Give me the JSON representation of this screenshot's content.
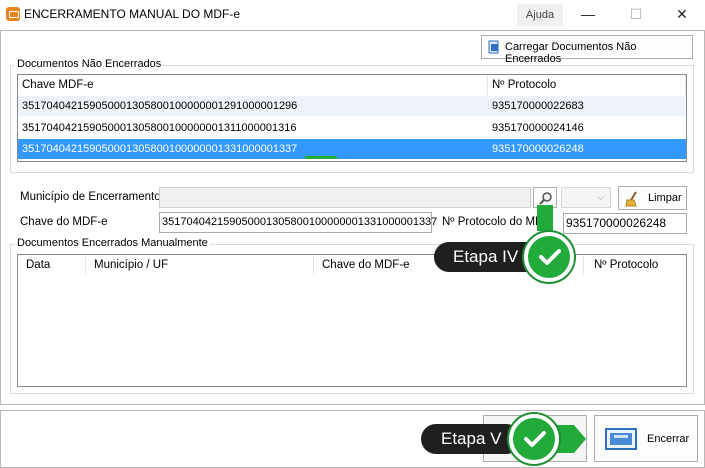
{
  "window": {
    "title": "ENCERRAMENTO MANUAL DO MDF-e",
    "help_label": "Ajuda",
    "minimize_glyph": "—",
    "maximize_glyph": "☐",
    "close_glyph": "✕"
  },
  "toolbar": {
    "load_button_label": "Carregar Documentos Não Encerrados"
  },
  "open_docs": {
    "group_label": "Documentos Não Encerrados",
    "columns": [
      "Chave MDF-e",
      "Nº Protocolo"
    ],
    "rows": [
      {
        "chave": "35170404215905000130580010000000129100000​1296",
        "protocolo": "935170000022683"
      },
      {
        "chave": "35170404215905000130580010000000131100000​1316",
        "protocolo": "935170000024146"
      },
      {
        "chave": "35170404215905000130580010000000133100000​1337",
        "protocolo": "935170000026248"
      }
    ]
  },
  "form": {
    "municipio_label": "Município de Encerramento",
    "municipio_value": "",
    "clear_button_label": "Limpar",
    "chave_label": "Chave do MDF-e",
    "chave_value": "35170404215905000130580010000000133100000​1337",
    "protocolo_label": "Nº Protocolo do MDF",
    "protocolo_value": "935170000026248"
  },
  "closed_docs": {
    "group_label": "Documentos Encerrados Manualmente",
    "columns": [
      "Data",
      "Município / UF",
      "Chave do MDF-e",
      "Nº Protocolo"
    ]
  },
  "footer": {
    "close_button_label": "Encerrar"
  },
  "overlays": {
    "step4_label": "Etapa IV",
    "step5_label": "Etapa V"
  },
  "colors": {
    "selection": "#3399ff",
    "row_alt": "#eef3fa",
    "check_green": "#22aa3b",
    "pill_dark": "#1f1f1f"
  }
}
